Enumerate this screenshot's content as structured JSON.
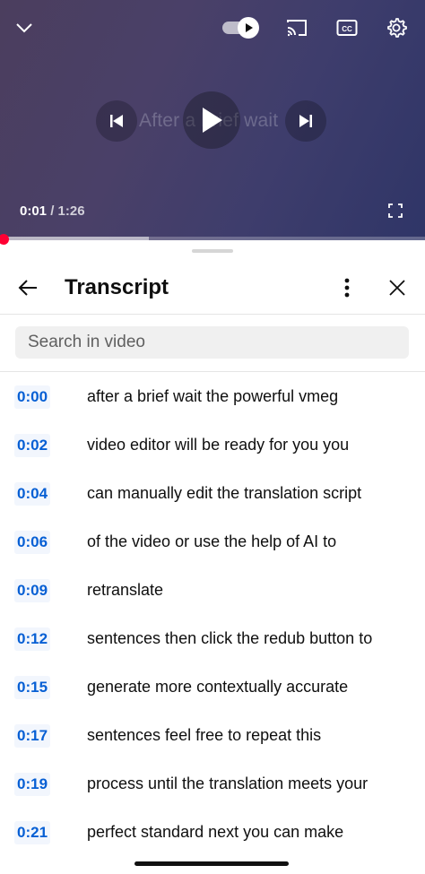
{
  "player": {
    "caption_ghost": "After a brief wait",
    "current_time": "0:01",
    "separator": " / ",
    "duration": "1:26",
    "progress_fraction": 0.012,
    "buffered_fraction": 0.35,
    "icons": {
      "collapse": "chevron-down-icon",
      "autoplay": "autoplay-toggle-icon",
      "cast": "cast-icon",
      "captions": "closed-captions-icon",
      "settings": "gear-icon",
      "previous": "skip-previous-icon",
      "play": "play-icon",
      "next": "skip-next-icon",
      "fullscreen": "fullscreen-icon"
    }
  },
  "transcript": {
    "title": "Transcript",
    "search_placeholder": "Search in video",
    "icons": {
      "back": "arrow-left-icon",
      "more": "more-vertical-icon",
      "close": "close-icon"
    },
    "segments": [
      {
        "time": "0:00",
        "text": "after a brief wait the powerful vmeg"
      },
      {
        "time": "0:02",
        "text": "video editor will be ready for you you"
      },
      {
        "time": "0:04",
        "text": "can manually edit the translation script"
      },
      {
        "time": "0:06",
        "text": "of the video or use the help of AI to"
      },
      {
        "time": "0:09",
        "text": "retranslate"
      },
      {
        "time": "0:12",
        "text": "sentences then click the redub button to"
      },
      {
        "time": "0:15",
        "text": "generate more contextually accurate"
      },
      {
        "time": "0:17",
        "text": "sentences feel free to repeat this"
      },
      {
        "time": "0:19",
        "text": "process until the translation meets your"
      },
      {
        "time": "0:21",
        "text": "perfect standard next you can make"
      }
    ]
  },
  "colors": {
    "accent_blue": "#065fd4",
    "progress_red": "#ff0000",
    "text_primary": "#0f0f0f"
  }
}
